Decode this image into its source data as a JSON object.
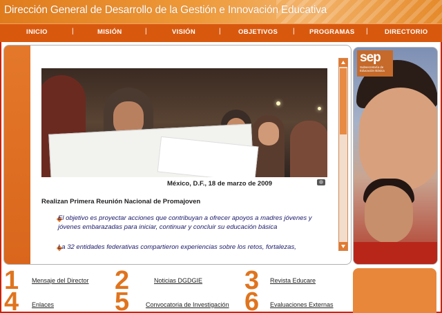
{
  "header": {
    "title": "Dirección General de Desarrollo de la Gestión e Innovación Educativa"
  },
  "nav": {
    "items": [
      "INICIO",
      "MISIÓN",
      "VISIÓN",
      "OBJETIVOS",
      "PROGRAMAS",
      "DIRECTORIO"
    ],
    "separator": "|"
  },
  "article": {
    "photo_caption": "México, D.F., 18 de marzo de 2009",
    "headline": "Realizan Primera Reunión Nacional de Promajoven",
    "bullets": [
      "El objetivo es proyectar acciones que contribuyan a ofrecer apoyos a madres jóvenes y jóvenes embarazadas para iniciar, continuar y concluir su educación básica",
      "La 32 entidades federativas compartieron experiencias sobre los retos, fortalezas,"
    ]
  },
  "side_logo": {
    "mark": "sep",
    "text": "Subsecretaría de Educación Básica"
  },
  "bottom_links": [
    {
      "number": "1",
      "label": "Mensaje del Director"
    },
    {
      "number": "2",
      "label": "Noticias DGDGIE"
    },
    {
      "number": "3",
      "label": "Revista Educare"
    },
    {
      "number": "4",
      "label": "Enlaces"
    },
    {
      "number": "5",
      "label": "Convocatoria de Investigación"
    },
    {
      "number": "6",
      "label": "Evaluaciones Externas"
    }
  ],
  "colors": {
    "header_orange": "#e07b1c",
    "nav_orange": "#d8590e",
    "accent": "#e8873a",
    "frame_red": "#cc2200"
  },
  "icons": [
    "camera-icon",
    "scroll-up-icon",
    "scroll-down-icon",
    "bullet-icon"
  ]
}
